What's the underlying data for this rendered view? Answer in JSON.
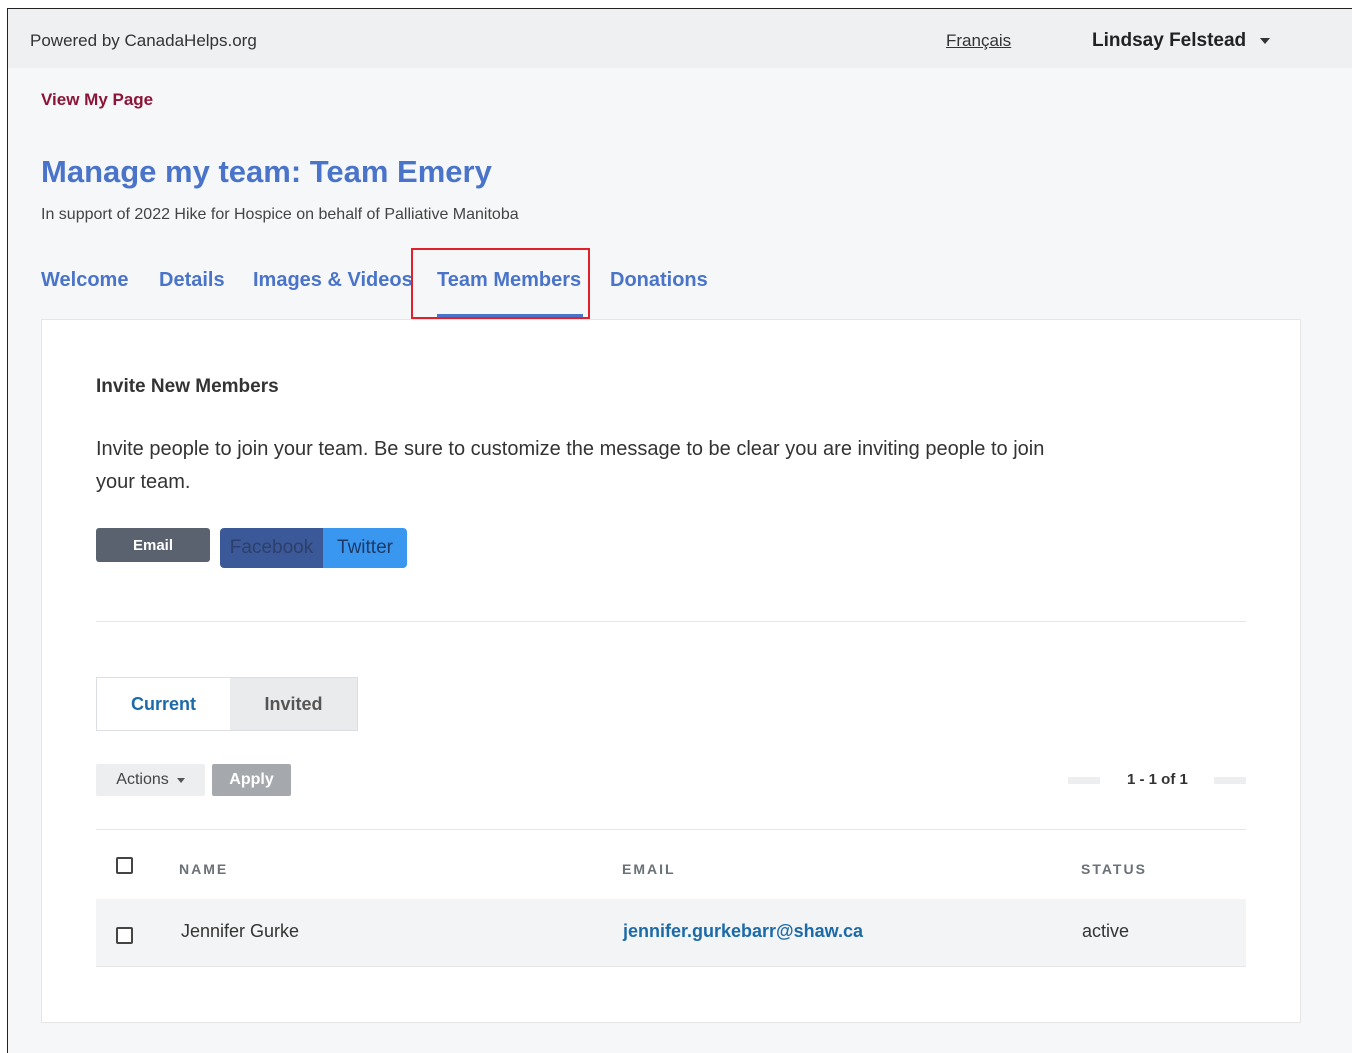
{
  "topbar": {
    "powered_by": "Powered by CanadaHelps.org",
    "language_link": "Français",
    "user_name": "Lindsay Felstead"
  },
  "header": {
    "view_my_page": "View My Page",
    "title": "Manage my team: Team Emery",
    "subtitle": "In support of 2022 Hike for Hospice on behalf of Palliative Manitoba"
  },
  "tabs": [
    {
      "label": "Welcome"
    },
    {
      "label": "Details"
    },
    {
      "label": "Images & Videos"
    },
    {
      "label": "Team Members",
      "active": true
    },
    {
      "label": "Donations"
    }
  ],
  "invite": {
    "title": "Invite New Members",
    "text": "Invite people to join your team. Be sure to customize the message to be clear you are inviting people to join your team.",
    "email_label": "Email",
    "facebook_label": "Facebook",
    "twitter_label": "Twitter"
  },
  "members": {
    "segments": [
      {
        "label": "Current",
        "selected": true
      },
      {
        "label": "Invited",
        "selected": false
      }
    ],
    "actions_label": "Actions",
    "apply_label": "Apply",
    "pagination": "1 - 1 of 1",
    "columns": {
      "name": "NAME",
      "email": "EMAIL",
      "status": "STATUS"
    },
    "rows": [
      {
        "name": "Jennifer Gurke",
        "email": "jennifer.gurkebarr@shaw.ca",
        "status": "active"
      }
    ]
  },
  "colors": {
    "accent_blue": "#4a74c9",
    "view_page_maroon": "#8b1538",
    "highlight_red": "#e0202a",
    "facebook_blue": "#3b5998",
    "twitter_blue": "#3a97f0"
  }
}
